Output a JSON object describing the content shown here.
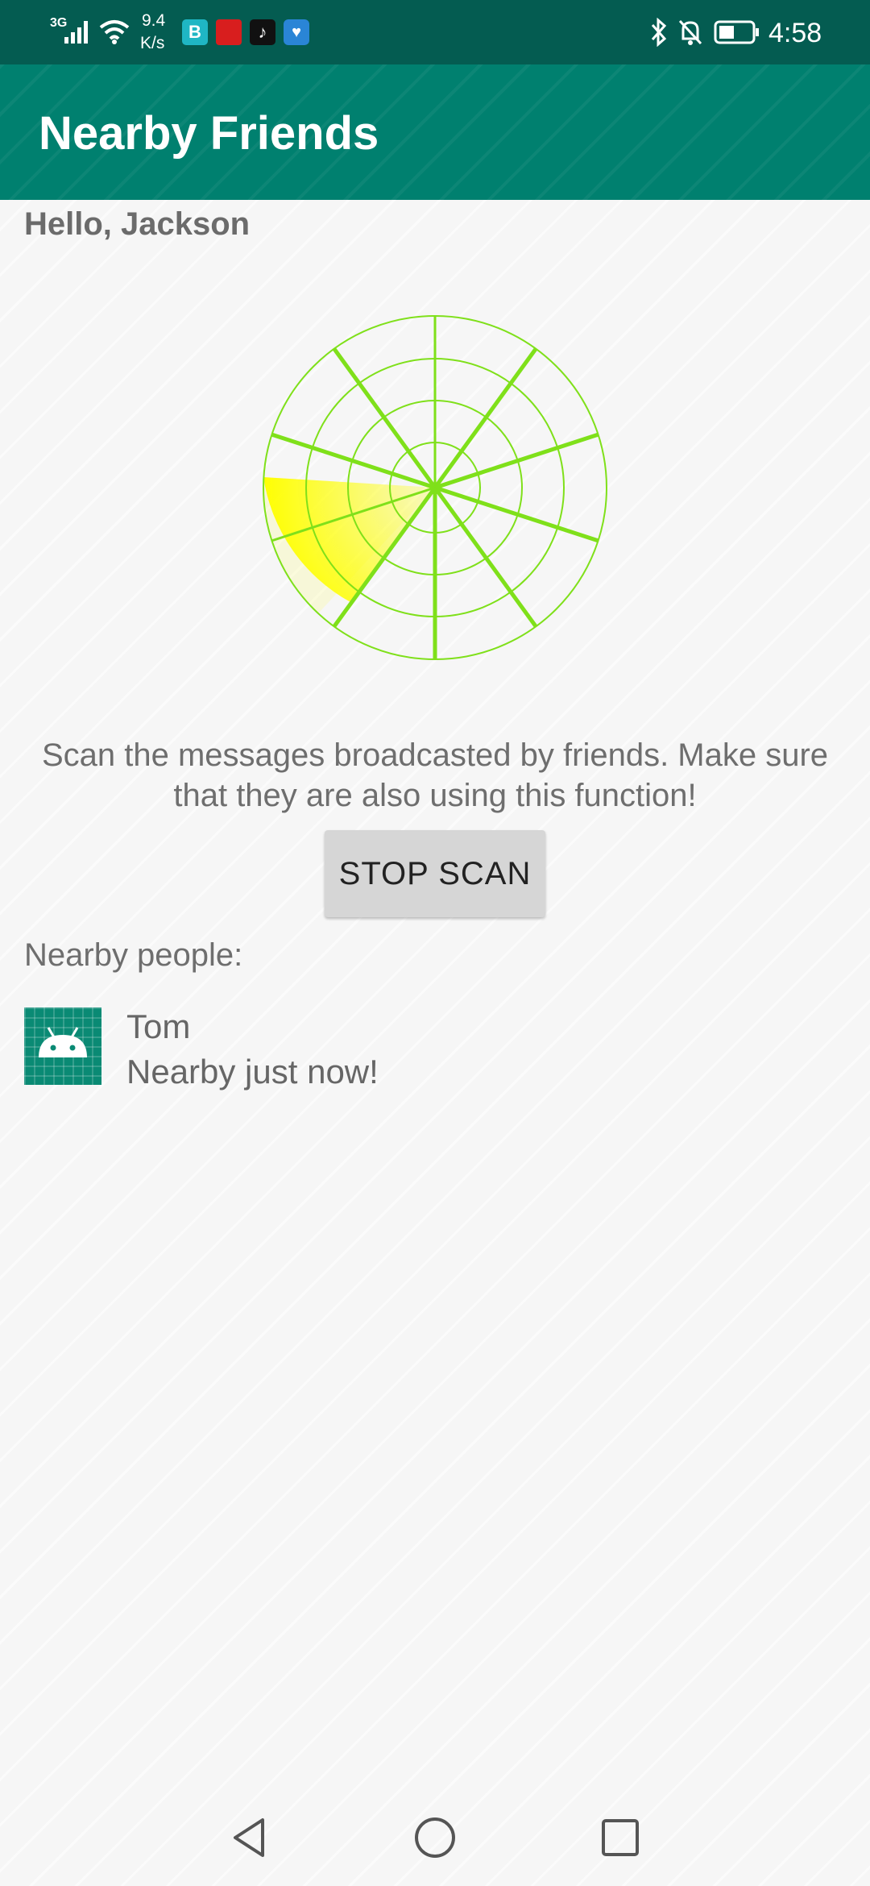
{
  "status_bar": {
    "network": "3G",
    "speed_value": "9.4",
    "speed_unit": "K/s",
    "time": "4:58",
    "icons": [
      "signal-icon",
      "wifi-icon",
      "app-b-icon",
      "news-app-icon",
      "tiktok-icon",
      "heart-app-icon",
      "bluetooth-icon",
      "mute-icon",
      "battery-icon"
    ]
  },
  "app_bar": {
    "title": "Nearby Friends"
  },
  "main": {
    "greeting": "Hello, Jackson",
    "scan_description": "Scan the messages broadcasted by friends. Make sure that they are also using this function!",
    "stop_button_label": "STOP SCAN",
    "nearby_label": "Nearby people:",
    "people": [
      {
        "name": "Tom",
        "status": "Nearby just now!",
        "avatar_icon": "android-icon"
      }
    ]
  },
  "radar": {
    "line_color": "#7fe01a",
    "sweep_color": "#ffff00"
  },
  "nav_bar": {
    "buttons": [
      "back-icon",
      "home-icon",
      "recents-icon"
    ]
  }
}
